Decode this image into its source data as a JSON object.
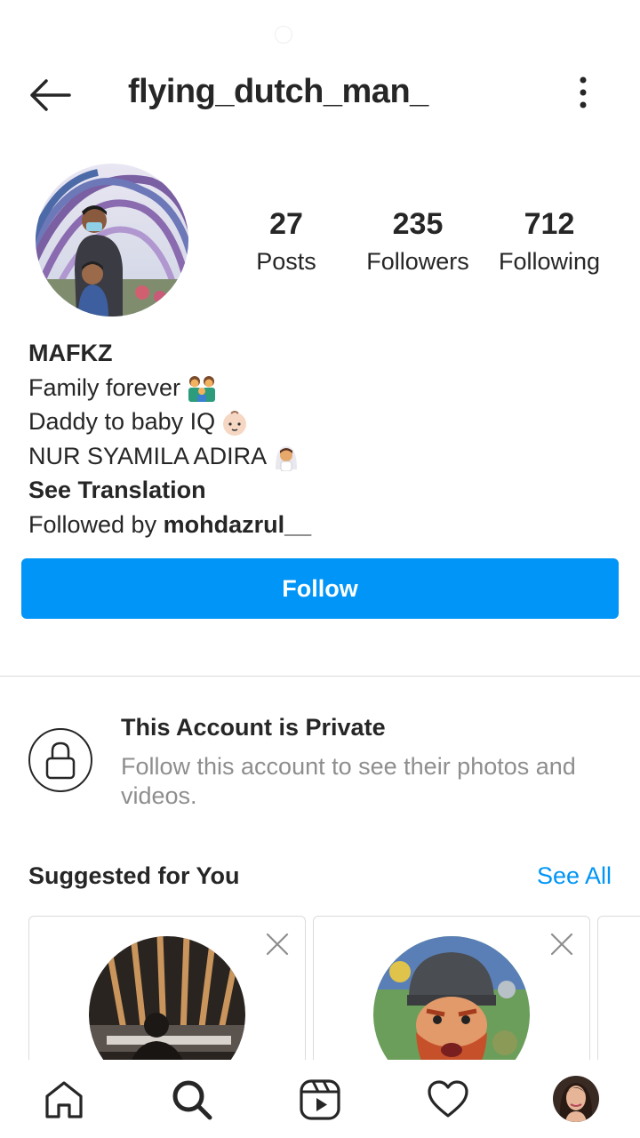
{
  "header": {
    "username": "flying_dutch_man_"
  },
  "stats": {
    "posts": {
      "count": "27",
      "label": "Posts"
    },
    "followers": {
      "count": "235",
      "label": "Followers"
    },
    "following": {
      "count": "712",
      "label": "Following"
    }
  },
  "bio": {
    "name": "MAFKZ",
    "line1": "Family forever",
    "line2": "Daddy to baby IQ",
    "line3": "NUR SYAMILA ADIRA",
    "see_translation": "See Translation",
    "followed_by_prefix": "Followed by ",
    "followed_by_user": "mohdazrul__"
  },
  "follow_button": "Follow",
  "private": {
    "title": "This Account is Private",
    "description": "Follow this account to see their photos and videos."
  },
  "suggested": {
    "title": "Suggested for You",
    "see_all": "See All"
  },
  "icons": {
    "back": "back-arrow-icon",
    "more": "more-vertical-icon",
    "lock": "lock-icon",
    "close": "close-icon",
    "home": "home-icon",
    "search": "search-icon",
    "reels": "reels-icon",
    "activity": "heart-icon"
  },
  "colors": {
    "accent": "#0095f6",
    "text": "#262626",
    "secondary_text": "#8e8e8e",
    "divider": "#dbdbdb"
  }
}
